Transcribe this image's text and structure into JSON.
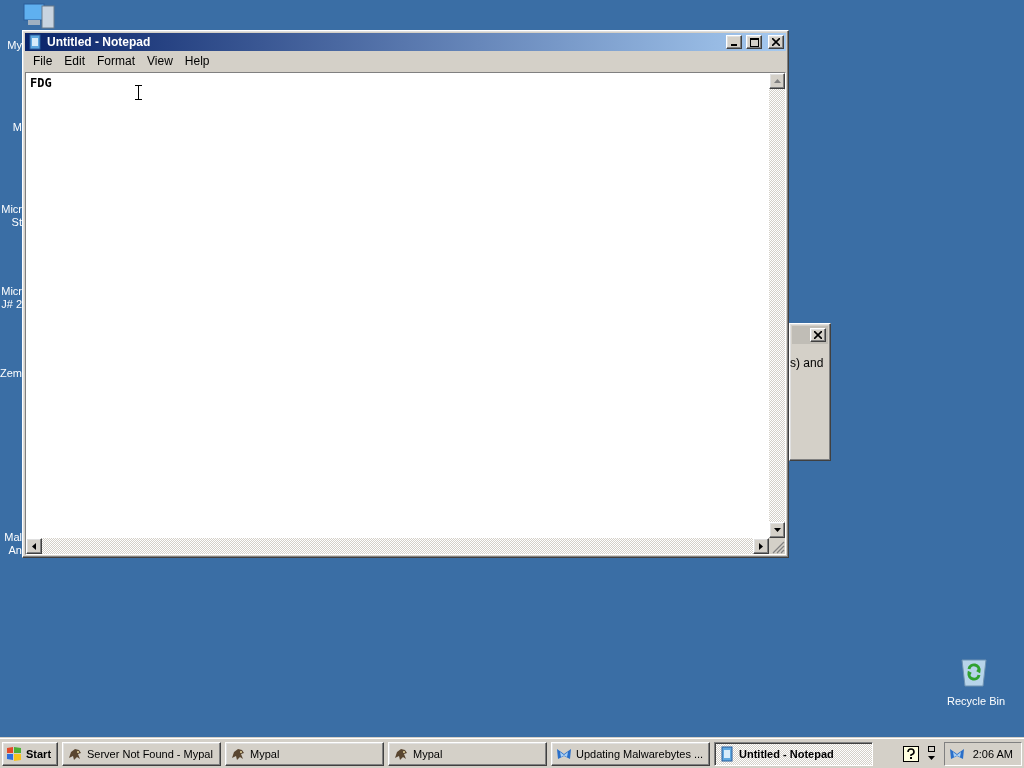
{
  "desktop_icons": [
    {
      "kind": "computer",
      "lines": [
        "My"
      ]
    },
    {
      "kind": "hidden",
      "lines": [
        "M"
      ]
    },
    {
      "kind": "hidden",
      "lines": [
        "Micr",
        "St"
      ]
    },
    {
      "kind": "hidden",
      "lines": [
        "Micr",
        "J# 2"
      ]
    },
    {
      "kind": "hidden",
      "lines": [
        "Zem"
      ]
    },
    {
      "kind": "hidden",
      "lines": [
        "Mal",
        "An"
      ]
    },
    {
      "kind": "recycle",
      "lines": [
        "Recycle Bin"
      ]
    }
  ],
  "notepad": {
    "title": "Untitled - Notepad",
    "menu": [
      "File",
      "Edit",
      "Format",
      "View",
      "Help"
    ],
    "text": "FDG"
  },
  "background_dialog": {
    "text": "s) and"
  },
  "taskbar": {
    "start": "Start",
    "buttons": [
      {
        "label": "Server Not Found - Mypal",
        "kind": "browser",
        "selected": false
      },
      {
        "label": "Mypal",
        "kind": "browser",
        "selected": false
      },
      {
        "label": "Mypal",
        "kind": "browser",
        "selected": false
      },
      {
        "label": "Updating Malwarebytes ...",
        "kind": "updater",
        "selected": false
      },
      {
        "label": "Untitled - Notepad",
        "kind": "editor",
        "selected": true
      }
    ],
    "clock": "2:06 AM"
  }
}
